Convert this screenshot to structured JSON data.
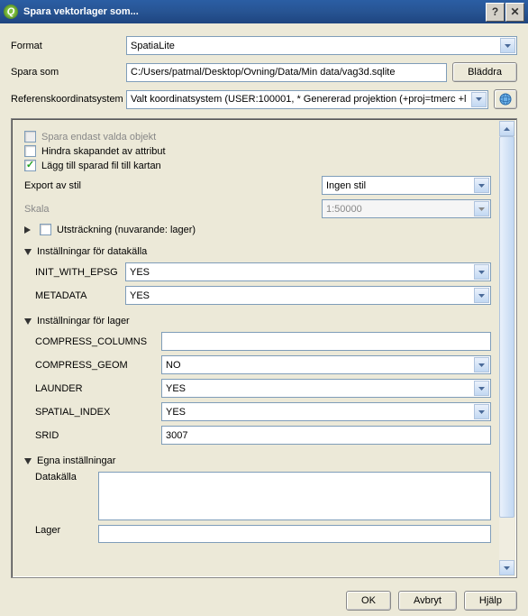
{
  "title": "Spara vektorlager som...",
  "top": {
    "format_label": "Format",
    "format_value": "SpatiaLite",
    "saveas_label": "Spara som",
    "saveas_value": "C:/Users/patmal/Desktop/Ovning/Data/Min data/vag3d.sqlite",
    "browse_label": "Bläddra",
    "crs_label": "Referenskoordinatsystem",
    "crs_value": "Valt koordinatsystem (USER:100001,  * Genererad projektion (+proj=tmerc +l"
  },
  "checks": {
    "save_selected": "Spara endast valda objekt",
    "prevent_attrs": "Hindra skapandet av attribut",
    "add_to_map": "Lägg till sparad fil till kartan"
  },
  "rows": {
    "export_style_label": "Export av stil",
    "export_style_value": "Ingen stil",
    "scale_label": "Skala",
    "scale_value": "1:50000",
    "extent_label": "Utsträckning (nuvarande: lager)"
  },
  "datasource": {
    "header": "Inställningar för datakälla",
    "init_epsg_label": "INIT_WITH_EPSG",
    "init_epsg_value": "YES",
    "metadata_label": "METADATA",
    "metadata_value": "YES"
  },
  "layer": {
    "header": "Inställningar för lager",
    "compress_cols_label": "COMPRESS_COLUMNS",
    "compress_cols_value": "",
    "compress_geom_label": "COMPRESS_GEOM",
    "compress_geom_value": "NO",
    "launder_label": "LAUNDER",
    "launder_value": "YES",
    "spatial_index_label": "SPATIAL_INDEX",
    "spatial_index_value": "YES",
    "srid_label": "SRID",
    "srid_value": "3007"
  },
  "custom": {
    "header": "Egna inställningar",
    "datasource_label": "Datakälla",
    "layer_label": "Lager"
  },
  "buttons": {
    "ok": "OK",
    "cancel": "Avbryt",
    "help": "Hjälp"
  }
}
